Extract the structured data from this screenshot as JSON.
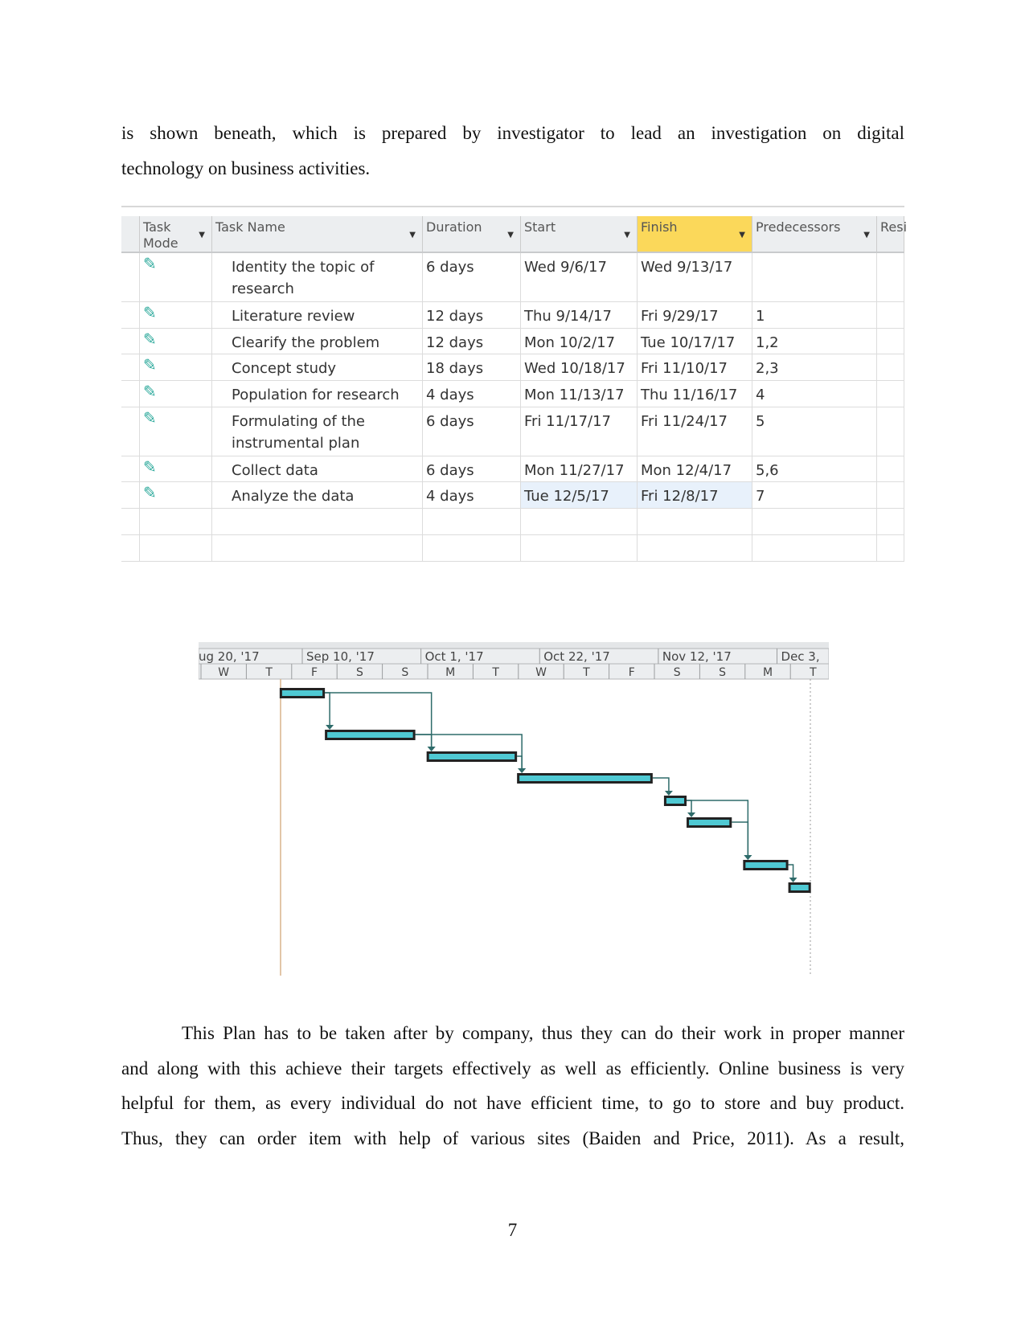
{
  "intro_lines": [
    "is shown beneath, which is prepared by investigator to lead an investigation on digital",
    "technology on business activities."
  ],
  "table": {
    "headers": [
      "Task Mode",
      "Task Name",
      "Duration",
      "Start",
      "Finish",
      "Predecessors",
      "Resi"
    ],
    "highlighted_header": "Finish",
    "rows": [
      {
        "mode": "manual-pin-icon",
        "name": "Identity the topic of research",
        "duration": "6 days",
        "start": "Wed 9/6/17",
        "finish": "Wed 9/13/17",
        "pred": ""
      },
      {
        "mode": "manual-pin-icon",
        "name": "Literature review",
        "duration": "12 days",
        "start": "Thu 9/14/17",
        "finish": "Fri 9/29/17",
        "pred": "1"
      },
      {
        "mode": "manual-pin-icon",
        "name": "Clearify the problem",
        "duration": "12 days",
        "start": "Mon 10/2/17",
        "finish": "Tue 10/17/17",
        "pred": "1,2"
      },
      {
        "mode": "manual-pin-icon",
        "name": "Concept study",
        "duration": "18 days",
        "start": "Wed 10/18/17",
        "finish": "Fri 11/10/17",
        "pred": "2,3"
      },
      {
        "mode": "manual-pin-icon",
        "name": "Population for research",
        "duration": "4 days",
        "start": "Mon 11/13/17",
        "finish": "Thu 11/16/17",
        "pred": "4"
      },
      {
        "mode": "manual-pin-icon",
        "name": "Formulating of the instrumental plan",
        "duration": "6 days",
        "start": "Fri 11/17/17",
        "finish": "Fri 11/24/17",
        "pred": "5"
      },
      {
        "mode": "manual-pin-icon",
        "name": "Collect data",
        "duration": "6 days",
        "start": "Mon 11/27/17",
        "finish": "Mon 12/4/17",
        "pred": "5,6"
      },
      {
        "mode": "manual-pin-icon",
        "name": "Analyze the data",
        "duration": "4 days",
        "start": "Tue 12/5/17",
        "finish": "Fri 12/8/17",
        "pred": "7"
      }
    ]
  },
  "chart_data": {
    "type": "gantt",
    "major_ticks": [
      "ug 20, '17",
      "Sep 10, '17",
      "Oct 1, '17",
      "Oct 22, '17",
      "Nov 12, '17",
      "Dec 3,"
    ],
    "minor_ticks": [
      "W",
      "T",
      "F",
      "S",
      "S",
      "M",
      "T",
      "W",
      "T",
      "F",
      "S",
      "S",
      "M",
      "T"
    ],
    "bar_color": "#4fc9d3",
    "tasks": [
      {
        "start": "2017-09-06",
        "finish": "2017-09-13",
        "predecessors": []
      },
      {
        "start": "2017-09-14",
        "finish": "2017-09-29",
        "predecessors": [
          1
        ]
      },
      {
        "start": "2017-10-02",
        "finish": "2017-10-17",
        "predecessors": [
          1,
          2
        ]
      },
      {
        "start": "2017-10-18",
        "finish": "2017-11-10",
        "predecessors": [
          2,
          3
        ]
      },
      {
        "start": "2017-11-13",
        "finish": "2017-11-16",
        "predecessors": [
          4
        ]
      },
      {
        "start": "2017-11-17",
        "finish": "2017-11-24",
        "predecessors": [
          5
        ]
      },
      {
        "start": "2017-11-27",
        "finish": "2017-12-04",
        "predecessors": [
          5,
          6
        ]
      },
      {
        "start": "2017-12-05",
        "finish": "2017-12-08",
        "predecessors": [
          7
        ]
      }
    ]
  },
  "body_lines": [
    "This Plan has to be taken after by company, thus they can do their work in proper manner",
    "and along with this achieve their targets effectively as well as efficiently. Online business is very",
    "helpful for them, as every individual do not have efficient time, to go to store and buy product.",
    "Thus, they can order item with help of various sites (Baiden and Price, 2011). As a result,"
  ],
  "page_number": "7"
}
